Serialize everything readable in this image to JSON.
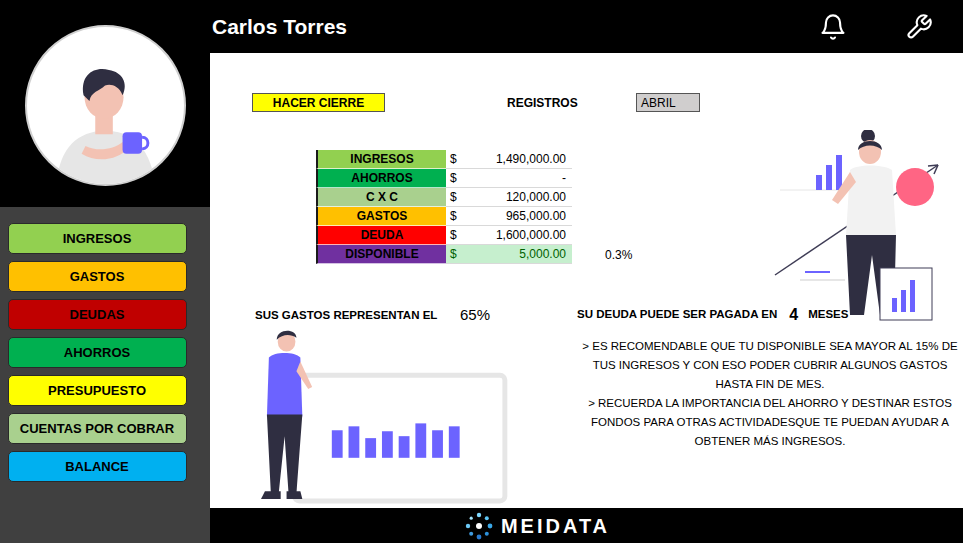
{
  "user": {
    "name": "Carlos Torres"
  },
  "sidebar": {
    "items": [
      {
        "label": "INGRESOS",
        "color": "#92d050"
      },
      {
        "label": "GASTOS",
        "color": "#ffc000"
      },
      {
        "label": "DEUDAS",
        "color": "#c00000"
      },
      {
        "label": "AHORROS",
        "color": "#00b050"
      },
      {
        "label": "PRESUPUESTO",
        "color": "#ffff00"
      },
      {
        "label": "CUENTAS POR COBRAR",
        "color": "#a9d08e"
      },
      {
        "label": "BALANCE",
        "color": "#00b0f0"
      }
    ]
  },
  "toolbar": {
    "close_button": "HACER CIERRE",
    "records_label": "REGISTROS",
    "month": "ABRIL"
  },
  "summary": {
    "rows": [
      {
        "label": "INGRESOS",
        "currency": "$",
        "amount": "1,490,000.00",
        "color": "#92d050",
        "highlighted": false
      },
      {
        "label": "AHORROS",
        "currency": "$",
        "amount": "-",
        "color": "#00b050",
        "highlighted": false
      },
      {
        "label": "C X C",
        "currency": "$",
        "amount": "120,000.00",
        "color": "#a9d08e",
        "highlighted": false
      },
      {
        "label": "GASTOS",
        "currency": "$",
        "amount": "965,000.00",
        "color": "#ffc000",
        "highlighted": false
      },
      {
        "label": "DEUDA",
        "currency": "$",
        "amount": "1,600,000.00",
        "color": "#ff0000",
        "highlighted": false
      },
      {
        "label": "DISPONIBLE",
        "currency": "$",
        "amount": "5,000.00",
        "color": "#7030a0",
        "highlighted": true
      }
    ],
    "available_percent": "0.3%"
  },
  "expenses": {
    "label": "SUS GASTOS REPRESENTAN EL",
    "value": "65%"
  },
  "debt": {
    "label": "SU DEUDA PUEDE SER PAGADA EN",
    "value": "4",
    "unit": "MESES"
  },
  "tips": [
    "> ES RECOMENDABLE QUE TU DISPONIBLE SEA MAYOR AL 15% DE TUS INGRESOS Y CON ESO PODER CUBRIR ALGUNOS GASTOS HASTA FIN DE MES.",
    "> RECUERDA LA IMPORTANCIA DEL AHORRO Y DESTINAR ESTOS FONDOS PARA OTRAS ACTIVIDADESQUE TE PUEDAN AYUDAR A OBTENER MÁS INGRESOS."
  ],
  "footer": {
    "logo": "MEIDATA"
  }
}
